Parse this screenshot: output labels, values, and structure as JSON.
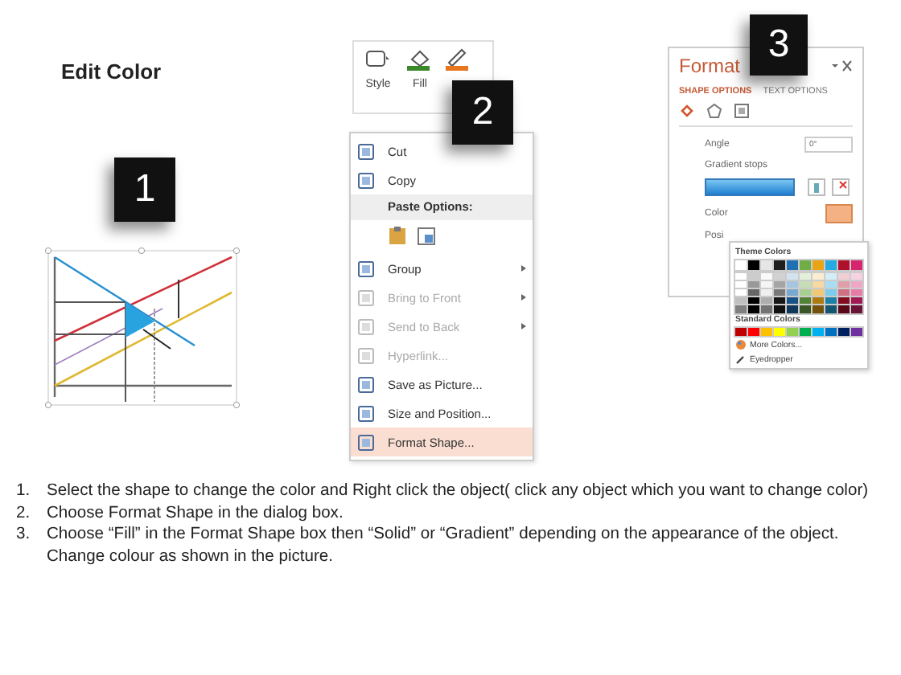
{
  "title": "Edit Color",
  "badges": [
    "1",
    "2",
    "3"
  ],
  "ribbon": {
    "buttons": [
      {
        "label": "Style",
        "kind": "style"
      },
      {
        "label": "Fill",
        "kind": "fill"
      }
    ]
  },
  "context_menu": {
    "top_items": [
      {
        "label": "Cut",
        "disabled": false,
        "selected": false
      },
      {
        "label": "Copy",
        "disabled": false,
        "selected": false
      }
    ],
    "paste_label": "Paste Options:",
    "items": [
      {
        "label": "Group",
        "disabled": false,
        "submenu": true,
        "selected": false
      },
      {
        "label": "Bring to Front",
        "disabled": true,
        "submenu": true,
        "selected": false
      },
      {
        "label": "Send to Back",
        "disabled": true,
        "submenu": true,
        "selected": false
      },
      {
        "label": "Hyperlink...",
        "disabled": true,
        "submenu": false,
        "selected": false
      },
      {
        "label": "Save as Picture...",
        "disabled": false,
        "submenu": false,
        "selected": false
      },
      {
        "label": "Size and Position...",
        "disabled": false,
        "submenu": false,
        "selected": false
      },
      {
        "label": "Format Shape...",
        "disabled": false,
        "submenu": false,
        "selected": true
      }
    ]
  },
  "format_pane": {
    "title": "Format",
    "tabs": [
      {
        "label": "SHAPE OPTIONS",
        "selected": true
      },
      {
        "label": "TEXT OPTIONS",
        "selected": false
      }
    ],
    "angle": {
      "label": "Angle",
      "value": "0°"
    },
    "gradient_stops": {
      "label": "Gradient stops"
    },
    "color": {
      "label": "Color"
    },
    "position": {
      "label": "Posi"
    }
  },
  "color_picker": {
    "theme_label": "Theme Colors",
    "standard_label": "Standard Colors",
    "more": "More Colors...",
    "eyedropper": "Eyedropper"
  },
  "instructions": [
    {
      "number": "1.",
      "text": "Select the shape to change the color and Right click the object( click any object which you want to change color)"
    },
    {
      "number": "2.",
      "text": "Choose Format Shape in the dialog box."
    },
    {
      "number": "3.",
      "text": "Choose “Fill” in the Format Shape box then “Solid” or “Gradient” depending on the appearance of the object. Change colour as shown in the picture."
    }
  ]
}
